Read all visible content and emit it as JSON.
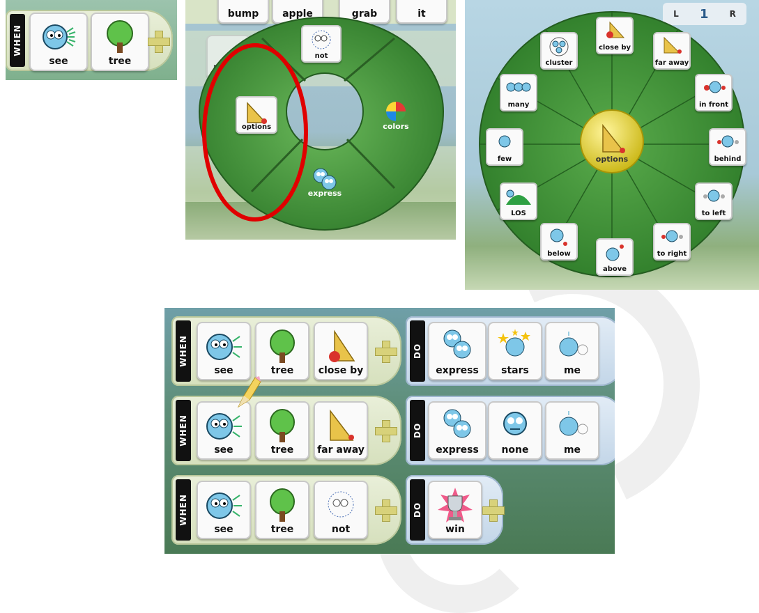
{
  "labels": {
    "when": "WHEN",
    "do": "DO"
  },
  "panel_a": {
    "sensor": "see",
    "filter": "tree"
  },
  "panel_b": {
    "bg_tiles": [
      "bump",
      "apple",
      "grab",
      "it",
      "bump"
    ],
    "items": {
      "not": "not",
      "options": "options",
      "colors": "colors",
      "express": "express"
    }
  },
  "panel_c": {
    "center": "options",
    "items": [
      "close by",
      "far away",
      "in front",
      "behind",
      "to left",
      "to right",
      "above",
      "below",
      "LOS",
      "few",
      "many",
      "cluster"
    ],
    "header_count": "1",
    "header_keys": [
      "L",
      "R"
    ]
  },
  "rules": [
    {
      "when": [
        "see",
        "tree",
        "close by"
      ],
      "do": [
        "express",
        "stars",
        "me"
      ]
    },
    {
      "when": [
        "see",
        "tree",
        "far away"
      ],
      "do": [
        "express",
        "none",
        "me"
      ]
    },
    {
      "when": [
        "see",
        "tree",
        "not"
      ],
      "do": [
        "win"
      ]
    }
  ],
  "colors": {
    "green_menu": "#4a9a3c",
    "selection_ring": "#e00000",
    "center_yellow": "#e8d81e"
  }
}
